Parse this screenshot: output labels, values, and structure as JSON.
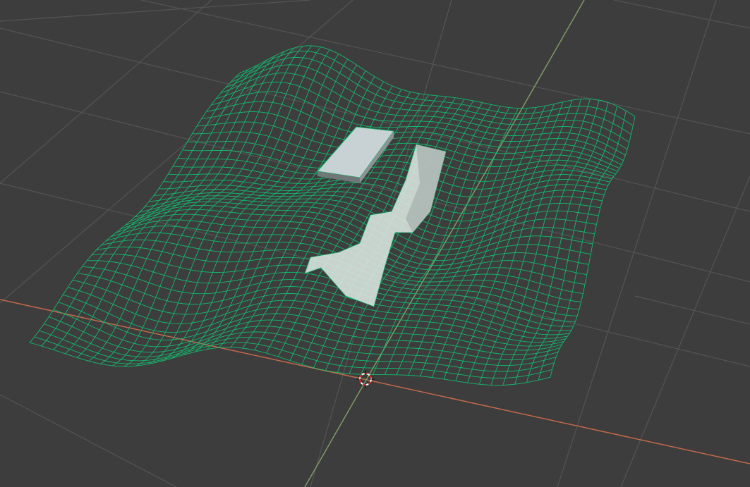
{
  "viewport": {
    "mode": "3D viewport",
    "icons": [
      "3d-cursor-icon"
    ]
  },
  "colors": {
    "background": "#3d3d3d",
    "grid": "#545454",
    "x_axis": "#c2684a",
    "y_axis": "#7f9a64",
    "wireframe": "#13b86e",
    "object_fill": "#c8d2d4"
  }
}
